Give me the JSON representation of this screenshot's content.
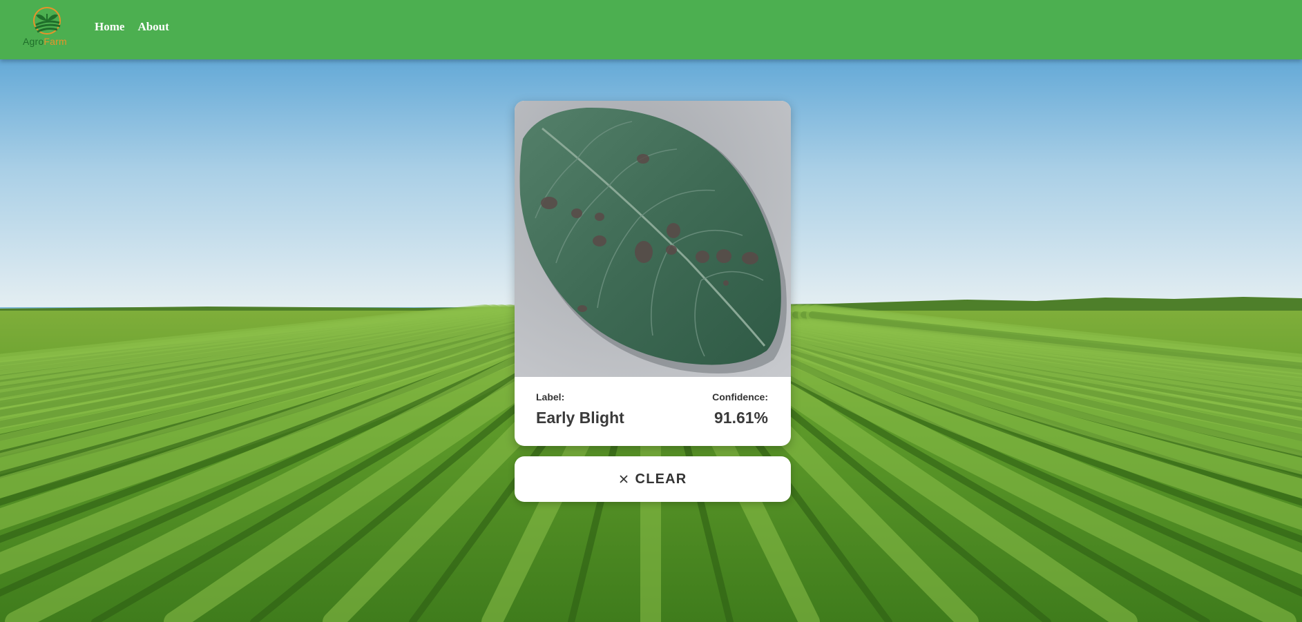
{
  "brand": {
    "name_part1": "Agro",
    "name_part2": "Farm",
    "icon": "agro-farm-logo",
    "colors": {
      "part1": "#1f6e2a",
      "part2": "#e8922a"
    }
  },
  "header": {
    "background": "#4caf50",
    "nav": [
      {
        "label": "Home"
      },
      {
        "label": "About"
      }
    ]
  },
  "result": {
    "image_subject": "potato-leaf-with-spots",
    "label_caption": "Label:",
    "label_value": "Early Blight",
    "confidence_caption": "Confidence:",
    "confidence_value": "91.61%"
  },
  "clear_button": {
    "icon": "close-icon",
    "label": "CLEAR"
  }
}
